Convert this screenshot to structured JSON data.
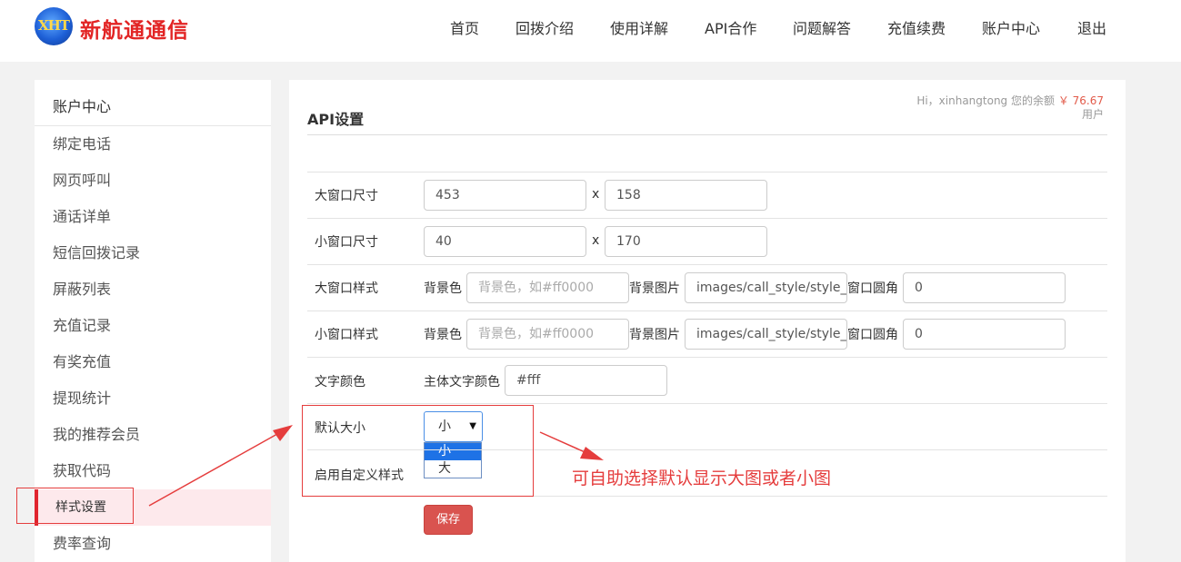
{
  "header": {
    "logo_mark": "XHT",
    "logo_text": "新航通通信",
    "nav": [
      "首页",
      "回拨介绍",
      "使用详解",
      "API合作",
      "问题解答",
      "充值续费",
      "账户中心",
      "退出"
    ]
  },
  "sidebar": {
    "title": "账户中心",
    "items": [
      "绑定电话",
      "网页呼叫",
      "通话详单",
      "短信回拨记录",
      "屏蔽列表",
      "充值记录",
      "有奖充值",
      "提现统计",
      "我的推荐会员",
      "获取代码",
      "样式设置",
      "费率查询"
    ],
    "active_index": 10
  },
  "main": {
    "title": "API设置",
    "greeting": "Hi，xinhangtong 您的余额",
    "balance": "￥ 76.67",
    "user_role": "用户",
    "big_size": {
      "label": "大窗口尺寸",
      "width": "453",
      "height": "158",
      "sep": "x"
    },
    "small_size": {
      "label": "小窗口尺寸",
      "width": "40",
      "height": "170",
      "sep": "x"
    },
    "big_style": {
      "label": "大窗口样式",
      "bg_label": "背景色",
      "bg_placeholder": "背景色，如#ff0000",
      "img_label": "背景图片",
      "img_value": "images/call_style/style_",
      "radius_label": "窗口圆角",
      "radius_value": "0"
    },
    "small_style": {
      "label": "小窗口样式",
      "bg_label": "背景色",
      "bg_placeholder": "背景色，如#ff0000",
      "img_label": "背景图片",
      "img_value": "images/call_style/style_",
      "radius_label": "窗口圆角",
      "radius_value": "0"
    },
    "text_color": {
      "label": "文字颜色",
      "sub_label": "主体文字颜色",
      "value": "#fff"
    },
    "default_size": {
      "label": "默认大小",
      "selected": "小",
      "options": [
        "小",
        "大"
      ]
    },
    "custom_style": {
      "label": "启用自定义样式"
    },
    "save_label": "保存"
  },
  "annotation": {
    "text": "可自助选择默认显示大图或者小图",
    "color": "#e53d3d"
  },
  "colors": {
    "brand_red": "#e22424",
    "accent_blue": "#1e72e6",
    "button_red": "#d9534f",
    "active_bg": "#fde9ec"
  }
}
